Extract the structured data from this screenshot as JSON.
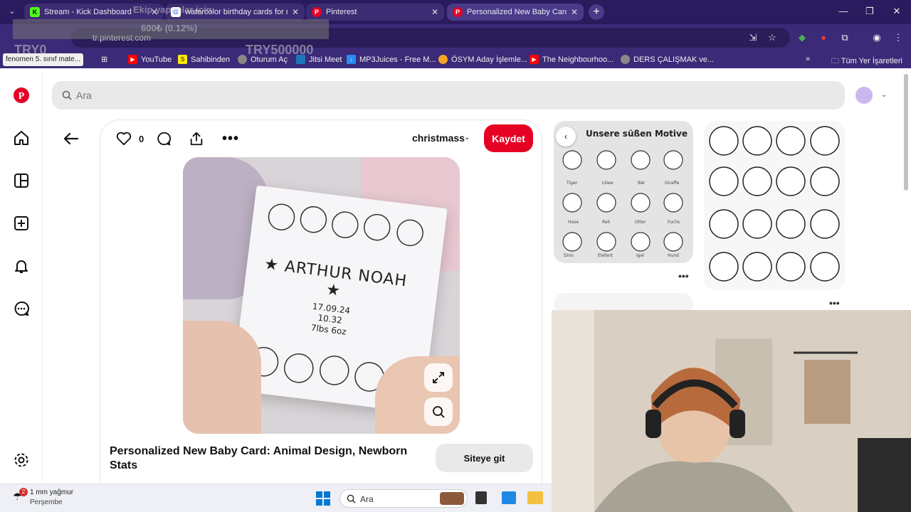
{
  "browser": {
    "tabs": [
      {
        "title": "Stream - Kick Dashboard",
        "favicon": "kick-icon",
        "color": "#53fc18",
        "glyph": "K"
      },
      {
        "title": "watercolor birthday cards for n",
        "favicon": "google-icon",
        "color": "#4285f4",
        "glyph": "G"
      },
      {
        "title": "Pinterest",
        "favicon": "pinterest-icon",
        "color": "#e60023",
        "glyph": "P"
      },
      {
        "title": "Personalized New Baby Card: A",
        "favicon": "pinterest-icon",
        "color": "#e60023",
        "glyph": "P"
      }
    ],
    "address": "tr.pinterest.com"
  },
  "bookmarks": [
    {
      "label": "fenomen 5. sınıf mate...",
      "icon": "page-icon"
    },
    {
      "label": "YouTube",
      "icon": "youtube-icon",
      "color": "#ff0000"
    },
    {
      "label": "Sahibinden",
      "icon": "sahibinden-icon",
      "color": "#ffe800",
      "glyph": "S"
    },
    {
      "label": "Oturum Aç",
      "icon": "globe-icon",
      "color": "#888888"
    },
    {
      "label": "Jitsi Meet",
      "icon": "jitsi-icon",
      "color": "#1d76ba"
    },
    {
      "label": "MP3Juices - Free M...",
      "icon": "download-icon",
      "color": "#2a8bf2"
    },
    {
      "label": "ÖSYM Aday İşlemle...",
      "icon": "osym-icon",
      "color": "#f5a623"
    },
    {
      "label": "The Neighbourhoo...",
      "icon": "youtube-icon",
      "color": "#ff0000"
    },
    {
      "label": "DERS ÇALIŞMAK ve...",
      "icon": "globe-icon",
      "color": "#888888"
    }
  ],
  "bookmarks_folder": "Tüm Yer İşaretleri",
  "overlay": {
    "line1": "Ekip yapanlar için",
    "line2": "600₺ (0.12%)",
    "left": "TRY0",
    "right": "TRY500000"
  },
  "search": {
    "placeholder": "Ara"
  },
  "pin": {
    "like_count": "0",
    "board": "christmass",
    "save_label": "Kaydet",
    "image_card": {
      "name": "ARTHUR NOAH",
      "date": "17.09.24",
      "time": "10.32",
      "weight": "7lbs 6oz"
    },
    "title": "Personalized New Baby Card: Animal Design, Newborn Stats",
    "visit_label": "Siteye git"
  },
  "related": {
    "first_title": "Unsere süßen Motive",
    "animal_labels": [
      "Tiger",
      "Löwe",
      "Bär",
      "Giraffe",
      "Hase",
      "Reh",
      "Otter",
      "Fuchs",
      "Dino",
      "Elefant",
      "Igel",
      "Hund"
    ]
  },
  "taskbar": {
    "weather_badge": "2",
    "weather_line1": "1 mm yağmur",
    "weather_line2": "Perşembe",
    "search_label": "Ara"
  },
  "colors": {
    "brand": "#e60023",
    "browser": "#2a1a5e"
  }
}
